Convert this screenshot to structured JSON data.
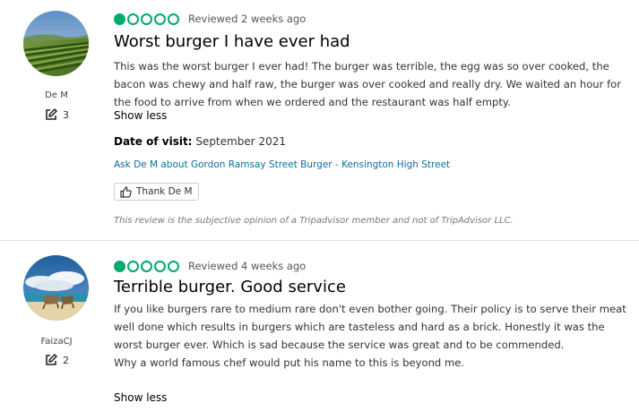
{
  "reviews": [
    {
      "user": {
        "name": "De M",
        "contributions": "3"
      },
      "rating": 1,
      "reviewed": "Reviewed 2 weeks ago",
      "title": "Worst burger I have ever had",
      "body": [
        "This was the worst burger I ever had! The burger was terrible, the egg was so over cooked, the bacon was chewy and half raw, the burger was over cooked and really dry. We waited an hour for the food to arrive from when we ordered and the restaurant was half empty."
      ],
      "show_less": "Show less",
      "date_of_visit_label": "Date of visit:",
      "date_of_visit": "September 2021",
      "ask_link": "Ask De M about Gordon Ramsay Street Burger - Kensington High Street",
      "thank_label": "Thank De M",
      "disclaimer": "This review is the subjective opinion of a Tripadvisor member and not of TripAdvisor LLC."
    },
    {
      "user": {
        "name": "FaizaCJ",
        "contributions": "2"
      },
      "rating": 1,
      "reviewed": "Reviewed 4 weeks ago",
      "title": "Terrible burger. Good service",
      "body": [
        "If you like burgers rare to medium rare don't even bother going. Their policy is to serve their meat well done which results in burgers which are tasteless and hard as a brick. Honestly it was the worst burger ever. Which is sad because the service was great and to be commended.",
        "Why a world famous chef would put his name to this is beyond me."
      ],
      "show_less": "Show less"
    }
  ],
  "colors": {
    "bubble": "#00aa6c",
    "link": "#0c6d9c"
  },
  "icons": {
    "contributions": "pencil-square-icon",
    "thank": "thumbs-up-icon",
    "rating": "rating-bubble-icon"
  }
}
